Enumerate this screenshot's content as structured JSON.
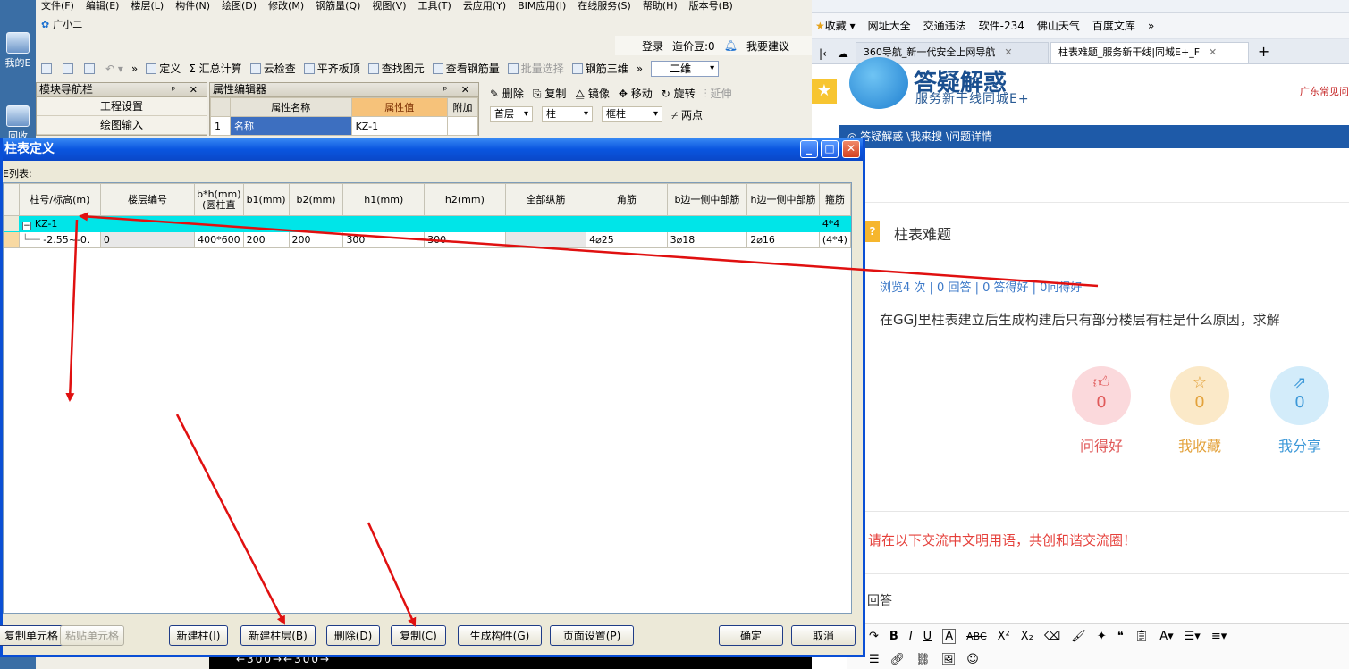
{
  "desktop": {
    "icons": [
      "我的E",
      "回收"
    ]
  },
  "app": {
    "menu": [
      "文件(F)",
      "编辑(E)",
      "楼层(L)",
      "构件(N)",
      "绘图(D)",
      "修改(M)",
      "钢筋量(Q)",
      "视图(V)",
      "工具(T)",
      "云应用(Y)",
      "BIM应用(I)",
      "在线服务(S)",
      "帮助(H)",
      "版本号(B)"
    ],
    "user": "广小二",
    "login": "登录",
    "price_beans": "造价豆:0",
    "suggest": "我要建议",
    "toolbar": [
      "定义",
      "汇总计算",
      "云检查",
      "平齐板顶",
      "查找图元",
      "查看钢筋量"
    ],
    "toolbar_disabled": "批量选择",
    "toolbar_more": [
      "钢筋三维"
    ],
    "view_mode": "二维",
    "nav_panel": {
      "title": "模块导航栏",
      "items": [
        "工程设置",
        "绘图输入"
      ]
    },
    "prop_panel": {
      "title": "属性编辑器",
      "headers": [
        "属性名称",
        "属性值",
        "附加"
      ],
      "rows": [
        {
          "no": "1",
          "name": "名称",
          "value": "KZ-1"
        }
      ]
    },
    "edit_toolbar": [
      "删除",
      "复制",
      "镜像",
      "移动",
      "旋转",
      "延伸"
    ],
    "floor_combo": "首层",
    "type_combo": "柱",
    "sub_combo": "框柱",
    "two_point": "两点",
    "cad_text": "←300→←300→"
  },
  "browser": {
    "bookmarks": [
      "收藏",
      "网址大全",
      "交通违法",
      "软件-234",
      "佛山天气",
      "百度文库"
    ],
    "tabs": [
      {
        "label": "360导航_新一代安全上网导航",
        "active": false
      },
      {
        "label": "柱表难题_服务新干线|同城E+_F",
        "active": true
      }
    ],
    "site": {
      "title": "答疑解惑",
      "subtitle": "服务新干线同城E+",
      "right_link": "广东常见问",
      "breadcrumb": "答疑解惑 \\我来搜 \\问题详情"
    },
    "question": {
      "title": "柱表难题",
      "stats": "浏览4 次 | 0 回答 | 0 答得好 | 0问得好",
      "body": "在GGJ里柱表建立后生成构建后只有部分楼层有柱是什么原因，求解"
    },
    "actions": [
      {
        "icon": "thumb-up",
        "count": "0",
        "label": "问得好",
        "color": "#e05a5a",
        "bg": "#fbd9dc"
      },
      {
        "icon": "star",
        "count": "0",
        "label": "我收藏",
        "color": "#e3a23b",
        "bg": "#fbe9c8"
      },
      {
        "icon": "share",
        "count": "0",
        "label": "我分享",
        "color": "#3c98d8",
        "bg": "#d3ecfa"
      }
    ],
    "notice": "请在以下交流中文明用语，共创和谐交流圈！",
    "answer_label": "回答",
    "editor_tools": [
      "B",
      "I",
      "U",
      "A",
      "ABC",
      "X²",
      "X₂"
    ]
  },
  "dialog": {
    "title": "柱表定义",
    "list_caption": "E列表:",
    "columns": [
      "柱号/标高(m)",
      "楼层编号",
      "b*h(mm)(圆柱直",
      "b1(mm)",
      "b2(mm)",
      "h1(mm)",
      "h2(mm)",
      "全部纵筋",
      "角筋",
      "b边一侧中部筋",
      "h边一侧中部筋",
      "箍筋"
    ],
    "rows": [
      {
        "cells": [
          "KZ-1",
          "",
          "",
          "",
          "",
          "",
          "",
          "",
          "",
          "",
          "",
          "4*4"
        ]
      },
      {
        "cells": [
          "-2.55~-0.",
          "0",
          "400*600",
          "200",
          "200",
          "300",
          "300",
          "",
          "4⌀25",
          "3⌀18",
          "2⌀16",
          "(4*4)"
        ]
      }
    ],
    "buttons": [
      "复制单元格",
      "粘贴单元格",
      "新建柱(I)",
      "新建柱层(B)",
      "删除(D)",
      "复制(C)",
      "生成构件(G)",
      "页面设置(P)",
      "确定",
      "取消"
    ],
    "disabled_buttons": [
      "粘贴单元格"
    ]
  },
  "colors": {
    "title_blue": "#0a56e0",
    "selected_row": "#00e5e8",
    "annotation": "#e01010"
  }
}
